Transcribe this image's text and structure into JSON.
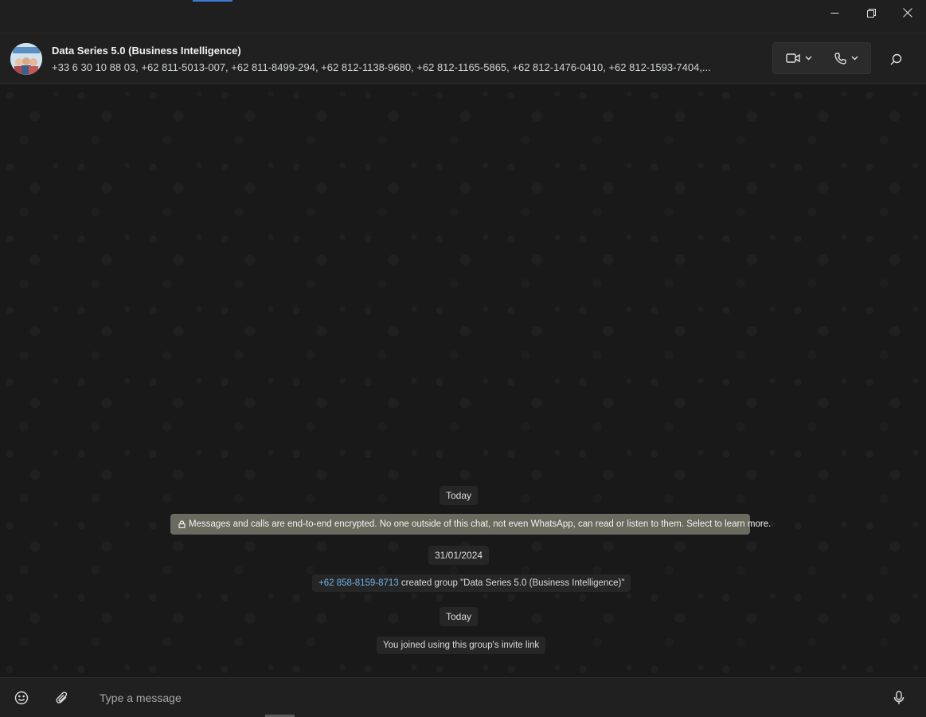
{
  "window": {
    "controls": [
      "minimize",
      "maximize",
      "close"
    ]
  },
  "header": {
    "group_name": "Data Series 5.0 (Business Intelligence)",
    "participants": "+33 6 30 10 88 03, +62 811-5013-007, +62 811-8499-294, +62 812-1138-9680, +62 812-1165-5865, +62 812-1476-0410, +62 812-1593-7404,...",
    "icons": {
      "video": "video-camera-icon",
      "voice": "phone-icon",
      "search": "search-icon"
    }
  },
  "messages": {
    "today_label_1": "Today",
    "encryption_notice": "Messages and calls are end-to-end encrypted. No one outside of this chat, not even WhatsApp, can read or listen to them. Select to learn more.",
    "date_label": "31/01/2024",
    "created_phone": "+62 858-8159-8713",
    "created_text": " created group \"Data Series 5.0 (Business Intelligence)\"",
    "today_label_2": "Today",
    "joined_text": "You joined using this group's invite link"
  },
  "composer": {
    "placeholder": "Type a message",
    "icons": {
      "emoji": "emoji-icon",
      "attach": "paperclip-icon",
      "mic": "microphone-icon"
    }
  },
  "colors": {
    "background": "#1f1f1f",
    "encryption_chip": "#6b6a5f",
    "link": "#6fb3e6"
  }
}
